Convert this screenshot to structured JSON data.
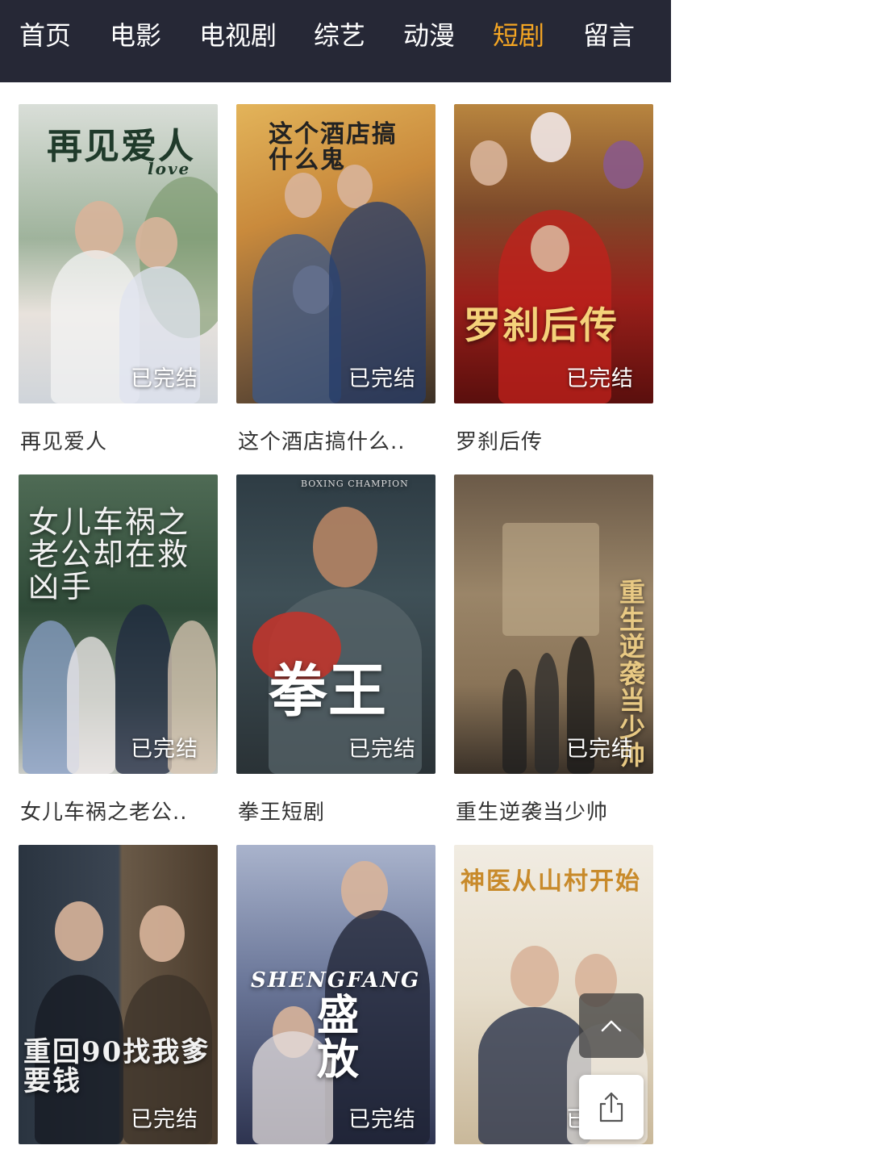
{
  "nav": {
    "items": [
      "首页",
      "电影",
      "电视剧",
      "综艺",
      "动漫",
      "短剧",
      "留言"
    ],
    "active_index": 5
  },
  "colors": {
    "nav_bg": "#262836",
    "active": "#f5a623",
    "caption": "#333333"
  },
  "cards": [
    {
      "title": "再见爱人",
      "status": "已完结",
      "poster_text": "再见爱人",
      "poster_sub": "love"
    },
    {
      "title": "这个酒店搞什么..",
      "status": "已完结",
      "poster_text": "这个酒店搞什么鬼"
    },
    {
      "title": "罗刹后传",
      "status": "已完结",
      "poster_text": "罗刹后传"
    },
    {
      "title": "女儿车祸之老公..",
      "status": "已完结",
      "poster_text": "女儿车祸之老公却在救凶手"
    },
    {
      "title": "拳王短剧",
      "status": "已完结",
      "poster_text": "拳王",
      "poster_sub": "BOXING CHAMPION"
    },
    {
      "title": "重生逆袭当少帅",
      "status": "已完结",
      "poster_text": "重生逆袭当少帅"
    },
    {
      "title": "",
      "status": "已完结",
      "poster_text": "重回90找我爹要钱"
    },
    {
      "title": "",
      "status": "已完结",
      "poster_text": "盛放",
      "poster_sub": "SHENGFANG"
    },
    {
      "title": "",
      "status": "已完结",
      "poster_text": "神医从山村开始"
    }
  ],
  "icons": {
    "back_to_top": "chevron-up-icon",
    "share": "share-icon"
  }
}
